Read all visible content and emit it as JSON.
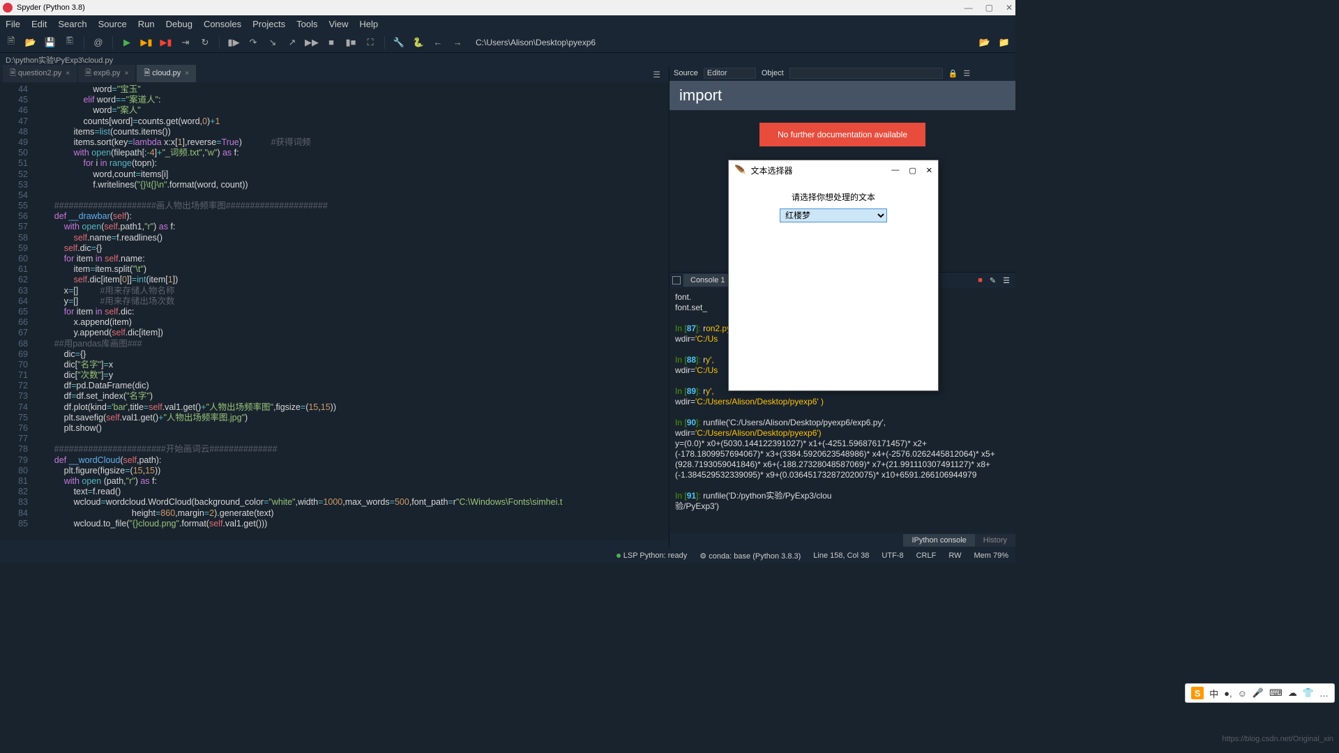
{
  "window": {
    "title": "Spyder (Python 3.8)"
  },
  "menu": [
    "File",
    "Edit",
    "Search",
    "Source",
    "Run",
    "Debug",
    "Consoles",
    "Projects",
    "Tools",
    "View",
    "Help"
  ],
  "cwd": "C:\\Users\\Alison\\Desktop\\pyexp6",
  "pathbar": "D:\\python实验\\PyExp3\\cloud.py",
  "tabs": [
    {
      "label": "question2.py",
      "active": false
    },
    {
      "label": "exp6.py",
      "active": false
    },
    {
      "label": "cloud.py",
      "active": true
    }
  ],
  "editor": {
    "first_line": 44,
    "lines": [
      {
        "indent": 24,
        "tokens": [
          [
            "",
            "word"
          ],
          [
            "op",
            "="
          ],
          [
            "str",
            "\"宝玉\""
          ]
        ]
      },
      {
        "indent": 20,
        "tokens": [
          [
            "kw",
            "elif"
          ],
          [
            "",
            " word"
          ],
          [
            "op",
            "=="
          ],
          [
            "str",
            "\"案道人\""
          ],
          [
            "",
            ":"
          ]
        ]
      },
      {
        "indent": 24,
        "tokens": [
          [
            "",
            "word"
          ],
          [
            "op",
            "="
          ],
          [
            "str",
            "\"案人\""
          ]
        ]
      },
      {
        "indent": 20,
        "tokens": [
          [
            "",
            "counts[word]"
          ],
          [
            "op",
            "="
          ],
          [
            "",
            "counts.get(word,"
          ],
          [
            "num",
            "0"
          ],
          [
            "",
            ")"
          ],
          [
            "op",
            "+"
          ],
          [
            "num",
            "1"
          ]
        ]
      },
      {
        "indent": 16,
        "tokens": [
          [
            "",
            "items"
          ],
          [
            "op",
            "="
          ],
          [
            "builtin",
            "list"
          ],
          [
            "",
            "(counts.items())"
          ]
        ]
      },
      {
        "indent": 16,
        "tokens": [
          [
            "",
            "items.sort(key"
          ],
          [
            "op",
            "="
          ],
          [
            "kw",
            "lambda"
          ],
          [
            "",
            " x:x["
          ],
          [
            "num",
            "1"
          ],
          [
            "",
            "],reverse"
          ],
          [
            "op",
            "="
          ],
          [
            "kw",
            "True"
          ],
          [
            "",
            ")"
          ],
          [
            "cmt",
            "            #获得词频"
          ]
        ]
      },
      {
        "indent": 16,
        "tokens": [
          [
            "kw",
            "with"
          ],
          [
            "",
            " "
          ],
          [
            "builtin",
            "open"
          ],
          [
            "",
            "(filepath[:"
          ],
          [
            "op",
            "-"
          ],
          [
            "num",
            "4"
          ],
          [
            "",
            "]"
          ],
          [
            "op",
            "+"
          ],
          [
            "str",
            "\"_词频.txt\""
          ],
          [
            "",
            ","
          ],
          [
            "str",
            "\"w\""
          ],
          [
            "",
            ") "
          ],
          [
            "kw",
            "as"
          ],
          [
            "",
            " f:"
          ]
        ]
      },
      {
        "indent": 20,
        "tokens": [
          [
            "kw",
            "for"
          ],
          [
            "",
            " i "
          ],
          [
            "kw",
            "in"
          ],
          [
            "",
            " "
          ],
          [
            "builtin",
            "range"
          ],
          [
            "",
            "(topn):"
          ]
        ]
      },
      {
        "indent": 24,
        "tokens": [
          [
            "",
            "word,count"
          ],
          [
            "op",
            "="
          ],
          [
            "",
            "items[i]"
          ]
        ]
      },
      {
        "indent": 24,
        "tokens": [
          [
            "",
            "f.writelines("
          ],
          [
            "str",
            "\"{}\\t{}\\n\""
          ],
          [
            "",
            ".format(word, count))"
          ]
        ]
      },
      {
        "indent": 0,
        "tokens": [
          [
            "",
            ""
          ]
        ]
      },
      {
        "indent": 8,
        "tokens": [
          [
            "cmt",
            "#####################画人物出场频率图#####################"
          ]
        ]
      },
      {
        "indent": 8,
        "tokens": [
          [
            "kw",
            "def"
          ],
          [
            "",
            " "
          ],
          [
            "fn",
            "__drawbar"
          ],
          [
            "",
            "("
          ],
          [
            "self",
            "self"
          ],
          [
            "",
            "):"
          ]
        ]
      },
      {
        "indent": 12,
        "tokens": [
          [
            "kw",
            "with"
          ],
          [
            "",
            " "
          ],
          [
            "builtin",
            "open"
          ],
          [
            "",
            "("
          ],
          [
            "self",
            "self"
          ],
          [
            "",
            ".path1,"
          ],
          [
            "str",
            "\"r\""
          ],
          [
            "",
            ") "
          ],
          [
            "kw",
            "as"
          ],
          [
            "",
            " f:"
          ]
        ]
      },
      {
        "indent": 16,
        "tokens": [
          [
            "self",
            "self"
          ],
          [
            "",
            ".name"
          ],
          [
            "op",
            "="
          ],
          [
            "",
            "f.readlines()"
          ]
        ]
      },
      {
        "indent": 12,
        "tokens": [
          [
            "self",
            "self"
          ],
          [
            "",
            ".dic"
          ],
          [
            "op",
            "="
          ],
          [
            "",
            "{}"
          ]
        ]
      },
      {
        "indent": 12,
        "tokens": [
          [
            "kw",
            "for"
          ],
          [
            "",
            " item "
          ],
          [
            "kw",
            "in"
          ],
          [
            "",
            " "
          ],
          [
            "self",
            "self"
          ],
          [
            "",
            ".name:"
          ]
        ]
      },
      {
        "indent": 16,
        "tokens": [
          [
            "",
            "item"
          ],
          [
            "op",
            "="
          ],
          [
            "",
            "item.split("
          ],
          [
            "str",
            "\"\\t\""
          ],
          [
            "",
            ")"
          ]
        ]
      },
      {
        "indent": 16,
        "tokens": [
          [
            "self",
            "self"
          ],
          [
            "",
            ".dic[item["
          ],
          [
            "num",
            "0"
          ],
          [
            "",
            "]]"
          ],
          [
            "op",
            "="
          ],
          [
            "builtin",
            "int"
          ],
          [
            "",
            "(item["
          ],
          [
            "num",
            "1"
          ],
          [
            "",
            "])"
          ]
        ]
      },
      {
        "indent": 12,
        "tokens": [
          [
            "",
            "x"
          ],
          [
            "op",
            "="
          ],
          [
            "",
            "[]"
          ],
          [
            "cmt",
            "         #用来存储人物名称"
          ]
        ]
      },
      {
        "indent": 12,
        "tokens": [
          [
            "",
            "y"
          ],
          [
            "op",
            "="
          ],
          [
            "",
            "[]"
          ],
          [
            "cmt",
            "         #用来存储出场次数"
          ]
        ]
      },
      {
        "indent": 12,
        "tokens": [
          [
            "kw",
            "for"
          ],
          [
            "",
            " item "
          ],
          [
            "kw",
            "in"
          ],
          [
            "",
            " "
          ],
          [
            "self",
            "self"
          ],
          [
            "",
            ".dic:"
          ]
        ]
      },
      {
        "indent": 16,
        "tokens": [
          [
            "",
            "x.append(item)"
          ]
        ]
      },
      {
        "indent": 16,
        "tokens": [
          [
            "",
            "y.append("
          ],
          [
            "self",
            "self"
          ],
          [
            "",
            ".dic[item])"
          ]
        ]
      },
      {
        "indent": 8,
        "tokens": [
          [
            "cmt",
            "##用pandas库画图###"
          ]
        ]
      },
      {
        "indent": 12,
        "tokens": [
          [
            "",
            "dic"
          ],
          [
            "op",
            "="
          ],
          [
            "",
            "{}"
          ]
        ]
      },
      {
        "indent": 12,
        "tokens": [
          [
            "",
            "dic["
          ],
          [
            "str",
            "\"名字\""
          ],
          [
            "",
            "]"
          ],
          [
            "op",
            "="
          ],
          [
            "",
            "x"
          ]
        ]
      },
      {
        "indent": 12,
        "tokens": [
          [
            "",
            "dic["
          ],
          [
            "str",
            "\"次数\""
          ],
          [
            "",
            "]"
          ],
          [
            "op",
            "="
          ],
          [
            "",
            "y"
          ]
        ]
      },
      {
        "indent": 12,
        "tokens": [
          [
            "",
            "df"
          ],
          [
            "op",
            "="
          ],
          [
            "",
            "pd.DataFrame(dic)"
          ]
        ]
      },
      {
        "indent": 12,
        "tokens": [
          [
            "",
            "df"
          ],
          [
            "op",
            "="
          ],
          [
            "",
            "df.set_index("
          ],
          [
            "str",
            "\"名字\""
          ],
          [
            "",
            ")"
          ]
        ]
      },
      {
        "indent": 12,
        "tokens": [
          [
            "",
            "df.plot(kind"
          ],
          [
            "op",
            "="
          ],
          [
            "str",
            "'bar'"
          ],
          [
            "",
            ",title"
          ],
          [
            "op",
            "="
          ],
          [
            "self",
            "self"
          ],
          [
            "",
            ".val1.get()"
          ],
          [
            "op",
            "+"
          ],
          [
            "str",
            "\"人物出场频率图\""
          ],
          [
            "",
            ",figsize"
          ],
          [
            "op",
            "="
          ],
          [
            "",
            "("
          ],
          [
            "num",
            "15"
          ],
          [
            "",
            ","
          ],
          [
            "num",
            "15"
          ],
          [
            "",
            "))"
          ]
        ]
      },
      {
        "indent": 12,
        "tokens": [
          [
            "",
            "plt.savefig("
          ],
          [
            "self",
            "self"
          ],
          [
            "",
            ".val1.get()"
          ],
          [
            "op",
            "+"
          ],
          [
            "str",
            "\"人物出场频率图.jpg\""
          ],
          [
            "",
            ")"
          ]
        ]
      },
      {
        "indent": 12,
        "tokens": [
          [
            "",
            "plt.show()"
          ]
        ]
      },
      {
        "indent": 0,
        "tokens": [
          [
            "",
            ""
          ]
        ]
      },
      {
        "indent": 8,
        "tokens": [
          [
            "cmt",
            "#######################开始画词云##############"
          ]
        ]
      },
      {
        "indent": 8,
        "tokens": [
          [
            "kw",
            "def"
          ],
          [
            "",
            " "
          ],
          [
            "fn",
            "__wordCloud"
          ],
          [
            "",
            "("
          ],
          [
            "self",
            "self"
          ],
          [
            "",
            ",path):"
          ]
        ]
      },
      {
        "indent": 12,
        "tokens": [
          [
            "",
            "plt.figure(figsize"
          ],
          [
            "op",
            "="
          ],
          [
            "",
            "("
          ],
          [
            "num",
            "15"
          ],
          [
            "",
            ","
          ],
          [
            "num",
            "15"
          ],
          [
            "",
            "))"
          ]
        ]
      },
      {
        "indent": 12,
        "tokens": [
          [
            "kw",
            "with"
          ],
          [
            "",
            " "
          ],
          [
            "builtin",
            "open"
          ],
          [
            "",
            " (path,"
          ],
          [
            "str",
            "\"r\""
          ],
          [
            "",
            ") "
          ],
          [
            "kw",
            "as"
          ],
          [
            "",
            " f:"
          ]
        ]
      },
      {
        "indent": 16,
        "tokens": [
          [
            "",
            "text"
          ],
          [
            "op",
            "="
          ],
          [
            "",
            "f.read()"
          ]
        ]
      },
      {
        "indent": 16,
        "tokens": [
          [
            "",
            "wcloud"
          ],
          [
            "op",
            "="
          ],
          [
            "",
            "wordcloud.WordCloud(background_color"
          ],
          [
            "op",
            "="
          ],
          [
            "str",
            "\"white\""
          ],
          [
            "",
            ",width"
          ],
          [
            "op",
            "="
          ],
          [
            "num",
            "1000"
          ],
          [
            "",
            ",max_words"
          ],
          [
            "op",
            "="
          ],
          [
            "num",
            "500"
          ],
          [
            "",
            ",font_path"
          ],
          [
            "op",
            "="
          ],
          [
            "",
            "r"
          ],
          [
            "str",
            "\"C:\\Windows\\Fonts\\simhei.t"
          ]
        ]
      },
      {
        "indent": 40,
        "tokens": [
          [
            "",
            "height"
          ],
          [
            "op",
            "="
          ],
          [
            "num",
            "860"
          ],
          [
            "",
            ",margin"
          ],
          [
            "op",
            "="
          ],
          [
            "num",
            "2"
          ],
          [
            "",
            ").generate(text)"
          ]
        ]
      },
      {
        "indent": 16,
        "tokens": [
          [
            "",
            "wcloud.to_file("
          ],
          [
            "str",
            "\"{}cloud.png\""
          ],
          [
            "",
            ".format("
          ],
          [
            "self",
            "self"
          ],
          [
            "",
            ".val1.get()))"
          ]
        ]
      }
    ]
  },
  "help": {
    "source_label": "Source",
    "source_value": "Editor",
    "object_label": "Object",
    "object_value": "",
    "title": "import",
    "warning": "No further documentation available"
  },
  "console": {
    "tab": "Console 1",
    "pre": [
      "font.",
      "  font.set_"
    ],
    "entries": [
      {
        "n": "87",
        "text": "r",
        "extra": "on2.py',",
        "wdir": "'C:/Us"
      },
      {
        "n": "88",
        "text": "r",
        "extra": "y',",
        "wdir": "'C:/Us"
      },
      {
        "n": "89",
        "text": "r",
        "extra": "y',",
        "wdir": "'C:/Users/Alison/Desktop/pyexp6' )"
      },
      {
        "n": "90",
        "text": "runfile('C:/Users/Alison/Desktop/pyexp6/exp6.py',",
        "wdir": "'C:/Users/Alison/Desktop/pyexp6')",
        "out": "y=(0.0)* x0+(5030.144122391027)* x1+(-4251.596876171457)* x2+(-178.1809957694067)* x3+(3384.5920623548986)* x4+(-2576.0262445812064)* x5+(928.7193059041846)* x6+(-188.27328048587069)* x7+(21.991110307491127)* x8+(-1.384529532339095)* x9+(0.036451732872020075)* x10+6591.266106944979"
      },
      {
        "n": "91",
        "text": "runfile('D:/python实验/PyExp3/clou",
        "wdir": "",
        "extra": "",
        "out": "验/PyExp3')"
      }
    ],
    "bottom_tabs": [
      "IPython console",
      "History"
    ]
  },
  "dialog": {
    "title": "文本选择器",
    "label": "请选择你想处理的文本",
    "selected": "红楼梦"
  },
  "status": {
    "lsp": "LSP Python: ready",
    "conda": "conda: base (Python 3.8.3)",
    "pos": "Line 158, Col 38",
    "enc": "UTF-8",
    "eol": "CRLF",
    "perm": "RW",
    "mem": "Mem 79%"
  },
  "watermark": "https://blog.csdn.net/Original_xin",
  "ime": [
    "S",
    "中",
    "●,",
    "☺",
    "🎤",
    "⌨",
    "☁",
    "👕",
    "…"
  ]
}
